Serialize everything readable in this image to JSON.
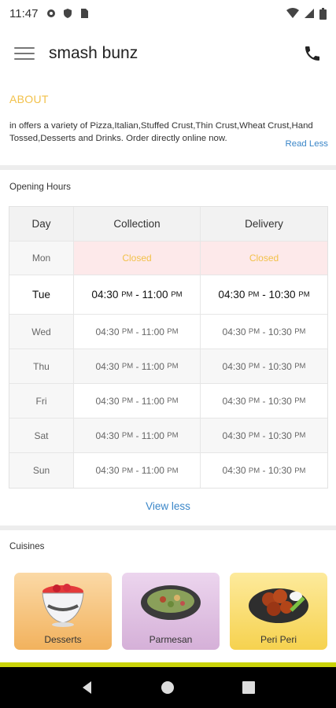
{
  "status": {
    "time": "11:47"
  },
  "appbar": {
    "title": "smash bunz"
  },
  "about": {
    "heading": "ABOUT",
    "text": "in  offers a variety of Pizza,Italian,Stuffed Crust,Thin Crust,Wheat Crust,Hand Tossed,Desserts  and Drinks. Order directly online now.",
    "read_less": "Read Less"
  },
  "opening_hours": {
    "label": "Opening Hours",
    "headers": {
      "day": "Day",
      "collection": "Collection",
      "delivery": "Delivery"
    },
    "closed_row": {
      "day": "Mon",
      "collection": "Closed",
      "delivery": "Closed"
    },
    "today": {
      "day": "Tue",
      "c_start": "04:30",
      "c_end": "11:00",
      "d_start": "04:30",
      "d_end": "10:30"
    },
    "rows": [
      {
        "day": "Wed",
        "c_start": "04:30",
        "c_end": "11:00",
        "d_start": "04:30",
        "d_end": "10:30"
      },
      {
        "day": "Thu",
        "c_start": "04:30",
        "c_end": "11:00",
        "d_start": "04:30",
        "d_end": "10:30"
      },
      {
        "day": "Fri",
        "c_start": "04:30",
        "c_end": "11:00",
        "d_start": "04:30",
        "d_end": "10:30"
      },
      {
        "day": "Sat",
        "c_start": "04:30",
        "c_end": "11:00",
        "d_start": "04:30",
        "d_end": "10:30"
      },
      {
        "day": "Sun",
        "c_start": "04:30",
        "c_end": "11:00",
        "d_start": "04:30",
        "d_end": "10:30"
      }
    ],
    "pm": "PM",
    "sep": " - ",
    "view_less": "View less"
  },
  "cuisines": {
    "label": "Cuisines",
    "items": [
      {
        "name": "Desserts",
        "icon": "dessert-bowl-icon"
      },
      {
        "name": "Parmesan",
        "icon": "salad-plate-icon"
      },
      {
        "name": "Peri Peri",
        "icon": "chicken-wings-icon"
      }
    ]
  },
  "colors": {
    "accent": "#f2c14a",
    "link": "#3a86c8",
    "closed_bg": "#fde9ea",
    "brand_bar": "#cad30a"
  }
}
